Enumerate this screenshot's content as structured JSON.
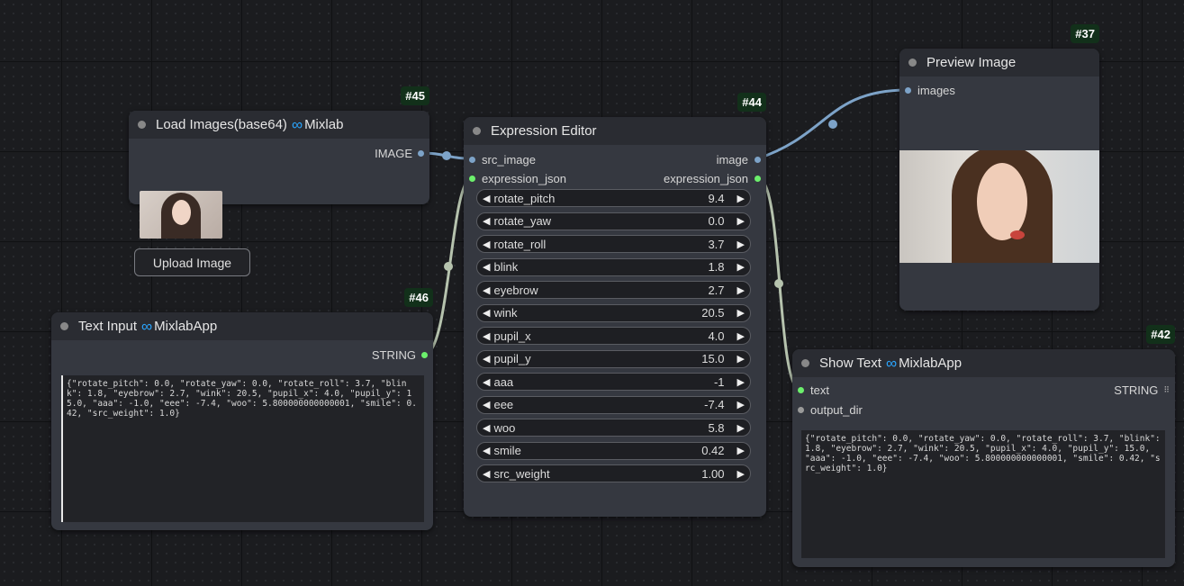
{
  "colors": {
    "canvas": "#1b1c1f",
    "node_body": "#353840",
    "node_header": "#2a2c32",
    "badge": "#12301a",
    "link_image": "#7da3c8",
    "link_string": "#b6c3ae",
    "port_green": "#6cf06c"
  },
  "nodes": {
    "load_images": {
      "badge": "#45",
      "title": "Load Images(base64)",
      "brand": "Mixlab",
      "output": "IMAGE",
      "upload_label": "Upload Image"
    },
    "text_input": {
      "badge": "#46",
      "title": "Text Input",
      "brand": "MixlabApp",
      "output": "STRING",
      "text": "{\"rotate_pitch\": 0.0, \"rotate_yaw\": 0.0, \"rotate_roll\": 3.7, \"blink\": 1.8, \"eyebrow\": 2.7, \"wink\": 20.5, \"pupil_x\": 4.0, \"pupil_y\": 15.0, \"aaa\": -1.0, \"eee\": -7.4, \"woo\": 5.800000000000001, \"smile\": 0.42, \"src_weight\": 1.0}"
    },
    "expression_editor": {
      "badge": "#44",
      "title": "Expression Editor",
      "inputs": [
        "src_image",
        "expression_json"
      ],
      "outputs": [
        "image",
        "expression_json"
      ],
      "widgets": [
        {
          "label": "rotate_pitch",
          "value": "9.4"
        },
        {
          "label": "rotate_yaw",
          "value": "0.0"
        },
        {
          "label": "rotate_roll",
          "value": "3.7"
        },
        {
          "label": "blink",
          "value": "1.8"
        },
        {
          "label": "eyebrow",
          "value": "2.7"
        },
        {
          "label": "wink",
          "value": "20.5"
        },
        {
          "label": "pupil_x",
          "value": "4.0"
        },
        {
          "label": "pupil_y",
          "value": "15.0"
        },
        {
          "label": "aaa",
          "value": "-1"
        },
        {
          "label": "eee",
          "value": "-7.4"
        },
        {
          "label": "woo",
          "value": "5.8"
        },
        {
          "label": "smile",
          "value": "0.42"
        },
        {
          "label": "src_weight",
          "value": "1.00"
        }
      ]
    },
    "preview_image": {
      "badge": "#37",
      "title": "Preview Image",
      "input": "images"
    },
    "show_text": {
      "badge": "#42",
      "title": "Show Text",
      "brand": "MixlabApp",
      "inputs": [
        "text",
        "output_dir"
      ],
      "output": "STRING",
      "text": "{\"rotate_pitch\": 0.0, \"rotate_yaw\": 0.0, \"rotate_roll\": 3.7, \"blink\": 1.8, \"eyebrow\": 2.7, \"wink\": 20.5, \"pupil_x\": 4.0, \"pupil_y\": 15.0, \"aaa\": -1.0, \"eee\": -7.4, \"woo\": 5.800000000000001, \"smile\": 0.42, \"src_weight\": 1.0}"
    }
  }
}
